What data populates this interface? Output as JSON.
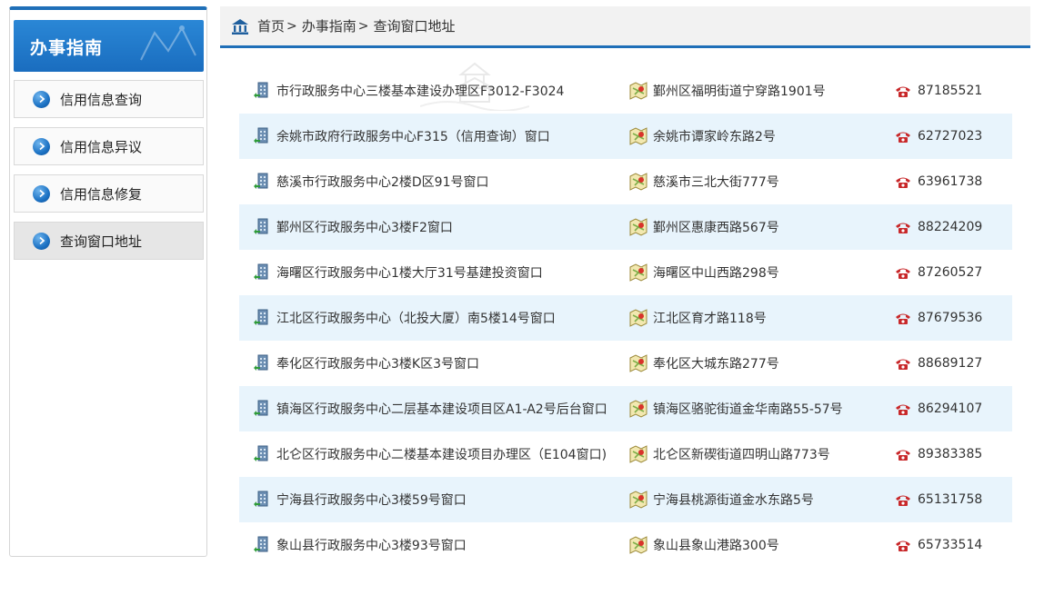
{
  "sidebar": {
    "title": "办事指南",
    "items": [
      {
        "label": "信用信息查询",
        "active": false
      },
      {
        "label": "信用信息异议",
        "active": false
      },
      {
        "label": "信用信息修复",
        "active": false
      },
      {
        "label": "查询窗口地址",
        "active": true
      }
    ]
  },
  "breadcrumb": [
    "首页",
    "办事指南",
    "查询窗口地址"
  ],
  "breadcrumb_separator": ">",
  "icons": {
    "home": "home-icon",
    "building": "building-icon",
    "map": "map-pin-icon",
    "phone": "phone-icon"
  },
  "colors": {
    "accent": "#1f6fb8",
    "row_alt": "#e8f4fc"
  },
  "windows": [
    {
      "name": "市行政服务中心三楼基本建设办理区F3012-F3024",
      "address": "鄞州区福明街道宁穿路1901号",
      "phone": "87185521"
    },
    {
      "name": "余姚市政府行政服务中心F315（信用查询）窗口",
      "address": "余姚市谭家岭东路2号",
      "phone": "62727023"
    },
    {
      "name": "慈溪市行政服务中心2楼D区91号窗口",
      "address": "慈溪市三北大街777号",
      "phone": "63961738"
    },
    {
      "name": "鄞州区行政服务中心3楼F2窗口",
      "address": "鄞州区惠康西路567号",
      "phone": "88224209"
    },
    {
      "name": "海曙区行政服务中心1楼大厅31号基建投资窗口",
      "address": "海曙区中山西路298号",
      "phone": "87260527"
    },
    {
      "name": "江北区行政服务中心（北投大厦）南5楼14号窗口",
      "address": "江北区育才路118号",
      "phone": "87679536"
    },
    {
      "name": "奉化区行政服务中心3楼K区3号窗口",
      "address": "奉化区大城东路277号",
      "phone": "88689127"
    },
    {
      "name": "镇海区行政服务中心二层基本建设项目区A1-A2号后台窗口",
      "address": "镇海区骆驼街道金华南路55-57号",
      "phone": "86294107"
    },
    {
      "name": "北仑区行政服务中心二楼基本建设项目办理区（E104窗口)",
      "address": "北仑区新碶街道四明山路773号",
      "phone": "89383385"
    },
    {
      "name": "宁海县行政服务中心3楼59号窗口",
      "address": "宁海县桃源街道金水东路5号",
      "phone": "65131758"
    },
    {
      "name": "象山县行政服务中心3楼93号窗口",
      "address": "象山县象山港路300号",
      "phone": "65733514"
    }
  ]
}
